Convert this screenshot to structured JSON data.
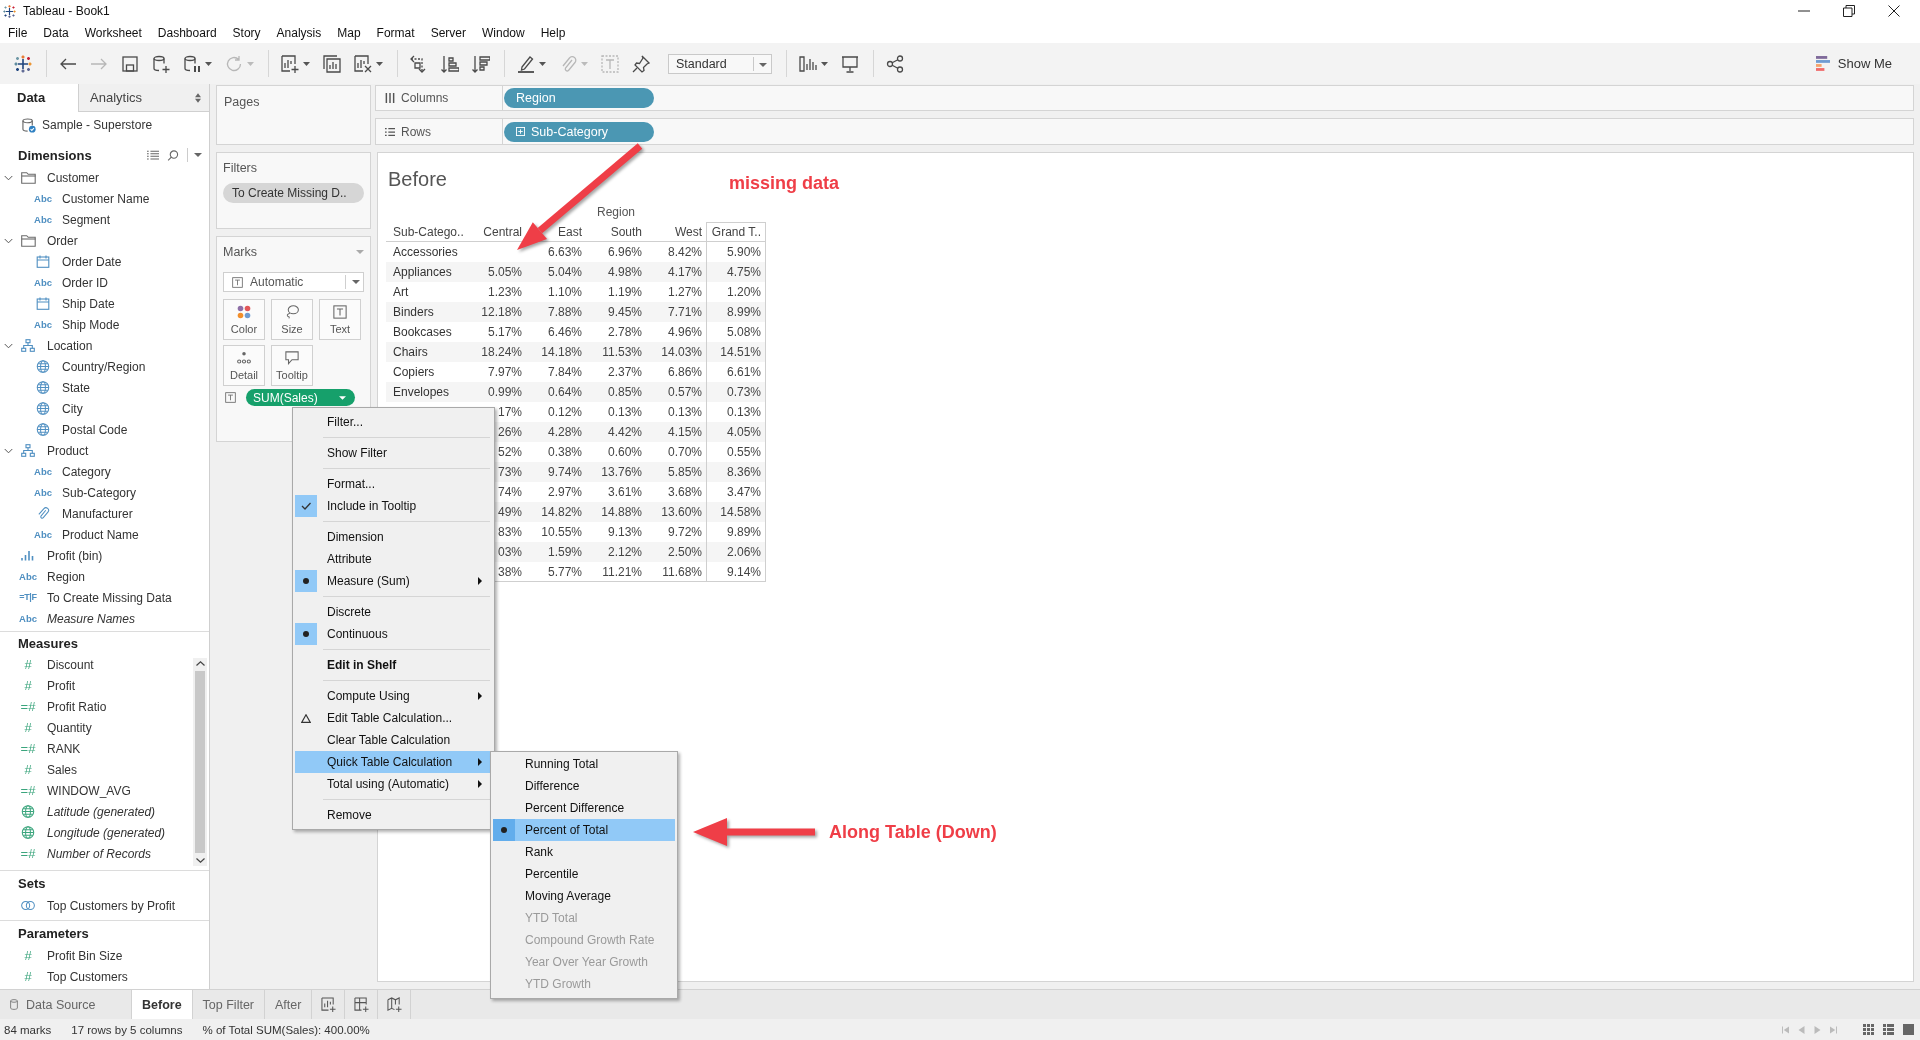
{
  "window": {
    "title": "Tableau - Book1"
  },
  "menu": [
    "File",
    "Data",
    "Worksheet",
    "Dashboard",
    "Story",
    "Analysis",
    "Map",
    "Format",
    "Server",
    "Window",
    "Help"
  ],
  "toolbar": {
    "groups": [
      [
        {
          "kind": "logo",
          "disabled": false,
          "dropdown": false
        }
      ],
      [
        {
          "kind": "undo",
          "disabled": false,
          "dropdown": false
        },
        {
          "kind": "redo",
          "disabled": true,
          "dropdown": false
        },
        {
          "kind": "save",
          "disabled": false,
          "dropdown": false
        },
        {
          "kind": "new-data-source",
          "disabled": false,
          "dropdown": false
        },
        {
          "kind": "pause-updates",
          "disabled": false,
          "dropdown": true
        },
        {
          "kind": "refresh",
          "disabled": true,
          "dropdown": true
        }
      ],
      [
        {
          "kind": "new-worksheet",
          "disabled": false,
          "dropdown": true
        },
        {
          "kind": "duplicate",
          "disabled": false,
          "dropdown": false
        },
        {
          "kind": "clear",
          "disabled": false,
          "dropdown": true
        }
      ],
      [
        {
          "kind": "swap",
          "disabled": false,
          "dropdown": false
        },
        {
          "kind": "sort-ascending",
          "disabled": false,
          "dropdown": false
        },
        {
          "kind": "sort-descending",
          "disabled": false,
          "dropdown": false
        }
      ],
      [
        {
          "kind": "highlight",
          "disabled": false,
          "dropdown": true
        },
        {
          "kind": "group",
          "disabled": true,
          "dropdown": true
        },
        {
          "kind": "labels",
          "disabled": true,
          "dropdown": false
        },
        {
          "kind": "pin",
          "disabled": false,
          "dropdown": false
        },
        {
          "kind": "fit",
          "label": "Standard",
          "disabled": false,
          "dropdown": true
        }
      ],
      [
        {
          "kind": "cards",
          "disabled": false,
          "dropdown": true
        },
        {
          "kind": "presentation",
          "disabled": false,
          "dropdown": false
        }
      ],
      [
        {
          "kind": "share",
          "disabled": false,
          "dropdown": false
        }
      ]
    ],
    "show_me": "Show Me"
  },
  "data_pane": {
    "tabs": [
      {
        "label": "Data",
        "selected": true
      },
      {
        "label": "Analytics",
        "selected": false
      }
    ],
    "data_source": "Sample - Superstore",
    "dimensions": {
      "title": "Dimensions",
      "items": [
        {
          "label": "Customer",
          "kind": "folder",
          "expanded": true,
          "generated": false,
          "children": [
            {
              "label": "Customer Name",
              "kind": "string",
              "glyph": "Abc",
              "generated": false
            },
            {
              "label": "Segment",
              "kind": "string",
              "glyph": "Abc",
              "generated": false
            }
          ]
        },
        {
          "label": "Order",
          "kind": "folder",
          "expanded": true,
          "generated": false,
          "children": [
            {
              "label": "Order Date",
              "kind": "date",
              "generated": false
            },
            {
              "label": "Order ID",
              "kind": "string",
              "glyph": "Abc",
              "generated": false
            },
            {
              "label": "Ship Date",
              "kind": "date",
              "generated": false
            },
            {
              "label": "Ship Mode",
              "kind": "string",
              "glyph": "Abc",
              "generated": false
            }
          ]
        },
        {
          "label": "Location",
          "kind": "hierarchy",
          "expanded": true,
          "generated": false,
          "children": [
            {
              "label": "Country/Region",
              "kind": "geo",
              "generated": false
            },
            {
              "label": "State",
              "kind": "geo",
              "generated": false
            },
            {
              "label": "City",
              "kind": "geo",
              "generated": false
            },
            {
              "label": "Postal Code",
              "kind": "geo",
              "generated": false
            }
          ]
        },
        {
          "label": "Product",
          "kind": "hierarchy",
          "expanded": true,
          "generated": false,
          "children": [
            {
              "label": "Category",
              "kind": "string",
              "glyph": "Abc",
              "generated": false
            },
            {
              "label": "Sub-Category",
              "kind": "string",
              "glyph": "Abc",
              "generated": false
            },
            {
              "label": "Manufacturer",
              "kind": "group",
              "generated": false
            },
            {
              "label": "Product Name",
              "kind": "string",
              "glyph": "Abc",
              "generated": false
            }
          ]
        },
        {
          "label": "Profit (bin)",
          "kind": "bin",
          "generated": false
        },
        {
          "label": "Region",
          "kind": "string",
          "glyph": "Abc",
          "generated": false
        },
        {
          "label": "To Create Missing Data",
          "kind": "boolean",
          "glyph": "=T|F",
          "generated": false
        },
        {
          "label": "Measure Names",
          "kind": "string",
          "glyph": "Abc",
          "generated": true
        }
      ]
    },
    "measures": {
      "title": "Measures",
      "items": [
        {
          "label": "Discount",
          "kind": "number",
          "glyph": "#",
          "generated": false
        },
        {
          "label": "Profit",
          "kind": "number",
          "glyph": "#",
          "generated": false
        },
        {
          "label": "Profit Ratio",
          "kind": "calc",
          "glyph": "=#",
          "generated": false
        },
        {
          "label": "Quantity",
          "kind": "number",
          "glyph": "#",
          "generated": false
        },
        {
          "label": "RANK",
          "kind": "calc",
          "glyph": "=#",
          "generated": false
        },
        {
          "label": "Sales",
          "kind": "number",
          "glyph": "#",
          "generated": false
        },
        {
          "label": "WINDOW_AVG",
          "kind": "calc",
          "glyph": "=#",
          "generated": false
        },
        {
          "label": "Latitude (generated)",
          "kind": "geo",
          "generated": true
        },
        {
          "label": "Longitude (generated)",
          "kind": "geo",
          "generated": true
        },
        {
          "label": "Number of Records",
          "kind": "calc",
          "glyph": "=#",
          "generated": true
        }
      ]
    },
    "sets": {
      "title": "Sets",
      "items": [
        {
          "label": "Top Customers by Profit",
          "kind": "set",
          "generated": false
        }
      ]
    },
    "parameters": {
      "title": "Parameters",
      "items": [
        {
          "label": "Profit Bin Size",
          "kind": "number",
          "glyph": "#",
          "generated": false
        },
        {
          "label": "Top Customers",
          "kind": "number",
          "glyph": "#",
          "generated": false
        }
      ]
    }
  },
  "pages": {
    "title": "Pages"
  },
  "filters": {
    "title": "Filters",
    "pills": [
      {
        "label": "To Create Missing D.."
      }
    ]
  },
  "marks": {
    "title": "Marks",
    "mark_type": "Automatic",
    "buttons": [
      {
        "label": "Color",
        "kind": "color"
      },
      {
        "label": "Size",
        "kind": "size"
      },
      {
        "label": "Text",
        "kind": "text"
      },
      {
        "label": "Detail",
        "kind": "detail"
      },
      {
        "label": "Tooltip",
        "kind": "tooltip"
      }
    ],
    "fields": [
      {
        "kind": "text",
        "label": "SUM(Sales)"
      }
    ]
  },
  "shelves": [
    {
      "kind": "columns",
      "label": "Columns",
      "pills": [
        {
          "label": "Region",
          "expandable": false
        }
      ]
    },
    {
      "kind": "rows",
      "label": "Rows",
      "pills": [
        {
          "label": "Sub-Category",
          "expandable": true
        }
      ]
    }
  ],
  "sheet": {
    "title": "Before",
    "column_group": "Region",
    "columns": [
      "Sub-Catego..",
      "Central",
      "East",
      "South",
      "West",
      "Grand T.."
    ],
    "rows": [
      {
        "label": "Accessories",
        "east": "6.63%",
        "south": "6.96%",
        "west": "8.42%",
        "grand_total": "5.90%"
      },
      {
        "label": "Appliances",
        "central": "5.05%",
        "east": "5.04%",
        "south": "4.98%",
        "west": "4.17%",
        "grand_total": "4.75%"
      },
      {
        "label": "Art",
        "central": "1.23%",
        "east": "1.10%",
        "south": "1.19%",
        "west": "1.27%",
        "grand_total": "1.20%"
      },
      {
        "label": "Binders",
        "central": "12.18%",
        "east": "7.88%",
        "south": "9.45%",
        "west": "7.71%",
        "grand_total": "8.99%"
      },
      {
        "label": "Bookcases",
        "central": "5.17%",
        "east": "6.46%",
        "south": "2.78%",
        "west": "4.96%",
        "grand_total": "5.08%"
      },
      {
        "label": "Chairs",
        "central": "18.24%",
        "east": "14.18%",
        "south": "11.53%",
        "west": "14.03%",
        "grand_total": "14.51%"
      },
      {
        "label": "Copiers",
        "central": "7.97%",
        "east": "7.84%",
        "south": "2.37%",
        "west": "6.86%",
        "grand_total": "6.61%"
      },
      {
        "label": "Envelopes",
        "central": "0.99%",
        "east": "0.64%",
        "south": "0.85%",
        "west": "0.57%",
        "grand_total": "0.73%"
      },
      {
        "central": "17%",
        "east": "0.12%",
        "south": "0.13%",
        "west": "0.13%",
        "grand_total": "0.13%"
      },
      {
        "central": "26%",
        "east": "4.28%",
        "south": "4.42%",
        "west": "4.15%",
        "grand_total": "4.05%"
      },
      {
        "central": "52%",
        "east": "0.38%",
        "south": "0.60%",
        "west": "0.70%",
        "grand_total": "0.55%"
      },
      {
        "central": "73%",
        "east": "9.74%",
        "south": "13.76%",
        "west": "5.85%",
        "grand_total": "8.36%"
      },
      {
        "central": "74%",
        "east": "2.97%",
        "south": "3.61%",
        "west": "3.68%",
        "grand_total": "3.47%"
      },
      {
        "central": "49%",
        "east": "14.82%",
        "south": "14.88%",
        "west": "13.60%",
        "grand_total": "14.58%"
      },
      {
        "central": "83%",
        "east": "10.55%",
        "south": "9.13%",
        "west": "9.72%",
        "grand_total": "9.89%"
      },
      {
        "central": "03%",
        "east": "1.59%",
        "south": "2.12%",
        "west": "2.50%",
        "grand_total": "2.06%"
      },
      {
        "central": "38%",
        "east": "5.77%",
        "south": "11.21%",
        "west": "11.68%",
        "grand_total": "9.14%"
      }
    ]
  },
  "context_menu": {
    "sections": [
      [
        {
          "label": "Filter...",
          "kind": "action",
          "checked": false,
          "selected": false,
          "submenu": false,
          "default": false
        }
      ],
      [
        {
          "label": "Show Filter",
          "kind": "action",
          "checked": false,
          "selected": false,
          "submenu": false,
          "default": false
        }
      ],
      [
        {
          "label": "Format...",
          "kind": "action",
          "checked": false,
          "selected": false,
          "submenu": false,
          "default": false
        },
        {
          "label": "Include in Tooltip",
          "kind": "check",
          "checked": true,
          "selected": false,
          "submenu": false,
          "default": false
        }
      ],
      [
        {
          "label": "Dimension",
          "kind": "radio",
          "checked": false,
          "selected": false,
          "submenu": false,
          "default": false
        },
        {
          "label": "Attribute",
          "kind": "radio",
          "checked": false,
          "selected": false,
          "submenu": false,
          "default": false
        },
        {
          "label": "Measure (Sum)",
          "kind": "radio",
          "checked": true,
          "selected": false,
          "submenu": true,
          "default": false
        }
      ],
      [
        {
          "label": "Discrete",
          "kind": "radio",
          "checked": false,
          "selected": false,
          "submenu": false,
          "default": false
        },
        {
          "label": "Continuous",
          "kind": "radio",
          "checked": true,
          "selected": false,
          "submenu": false,
          "default": false
        }
      ],
      [
        {
          "label": "Edit in Shelf",
          "kind": "action",
          "checked": false,
          "selected": false,
          "submenu": false,
          "default": true
        }
      ],
      [
        {
          "label": "Compute Using",
          "kind": "action",
          "checked": false,
          "selected": false,
          "submenu": true,
          "default": false
        },
        {
          "label": "Edit Table Calculation...",
          "kind": "calc",
          "checked": false,
          "selected": false,
          "submenu": false,
          "default": false
        },
        {
          "label": "Clear Table Calculation",
          "kind": "action",
          "checked": false,
          "selected": false,
          "submenu": false,
          "default": false
        },
        {
          "label": "Quick Table Calculation",
          "kind": "action",
          "checked": false,
          "selected": true,
          "submenu": true,
          "default": false
        },
        {
          "label": "Total using (Automatic)",
          "kind": "action",
          "checked": false,
          "selected": false,
          "submenu": true,
          "default": false
        }
      ],
      [
        {
          "label": "Remove",
          "kind": "action",
          "checked": false,
          "selected": false,
          "submenu": false,
          "default": false
        }
      ]
    ]
  },
  "quick_calc_menu": {
    "items": [
      {
        "label": "Running Total",
        "checked": false,
        "selected": false,
        "disabled": false
      },
      {
        "label": "Difference",
        "checked": false,
        "selected": false,
        "disabled": false
      },
      {
        "label": "Percent Difference",
        "checked": false,
        "selected": false,
        "disabled": false
      },
      {
        "label": "Percent of Total",
        "checked": true,
        "selected": true,
        "disabled": false
      },
      {
        "label": "Rank",
        "checked": false,
        "selected": false,
        "disabled": false
      },
      {
        "label": "Percentile",
        "checked": false,
        "selected": false,
        "disabled": false
      },
      {
        "label": "Moving Average",
        "checked": false,
        "selected": false,
        "disabled": false
      },
      {
        "label": "YTD Total",
        "checked": false,
        "selected": false,
        "disabled": true
      },
      {
        "label": "Compound Growth Rate",
        "checked": false,
        "selected": false,
        "disabled": true
      },
      {
        "label": "Year Over Year Growth",
        "checked": false,
        "selected": false,
        "disabled": true
      },
      {
        "label": "YTD Growth",
        "checked": false,
        "selected": false,
        "disabled": true
      }
    ]
  },
  "annotations": [
    {
      "kind": "arrow-callout",
      "text": "missing data"
    },
    {
      "kind": "arrow-callout",
      "text": "Along Table (Down)"
    }
  ],
  "sheet_tabs": [
    {
      "label": "Data Source",
      "kind": "data-source",
      "selected": false
    },
    {
      "label": "Before",
      "kind": "sheet",
      "selected": true
    },
    {
      "label": "Top Filter",
      "kind": "sheet",
      "selected": false
    },
    {
      "label": "After",
      "kind": "sheet",
      "selected": false
    }
  ],
  "status_bar": {
    "items": [
      "84 marks",
      "17 rows by 5 columns",
      "% of Total SUM(Sales): 400.00%"
    ]
  }
}
